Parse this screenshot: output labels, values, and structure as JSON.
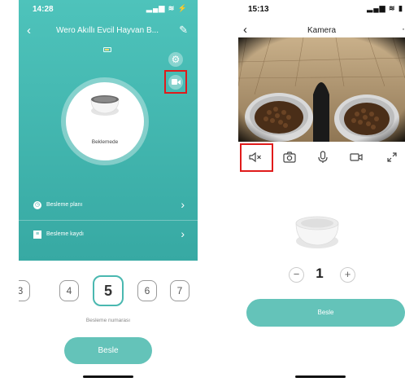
{
  "left": {
    "status": {
      "time": "14:28",
      "signal": "▂▄▆ ≋ ⚡"
    },
    "header": {
      "back": "‹",
      "title": "Wero Akıllı Evcil Hayvan B...",
      "edit": "✎"
    },
    "device_status": "Beklemede",
    "rows": [
      {
        "label": "Besleme planı",
        "icon": "clock-icon",
        "chevron": "›"
      },
      {
        "label": "Besleme kaydı",
        "icon": "list-icon",
        "chevron": "›"
      }
    ],
    "numbers": [
      "3",
      "4",
      "5",
      "6",
      "7"
    ],
    "selected_number": "5",
    "number_label": "Besleme numarası",
    "feed_button": "Besle",
    "colors": {
      "accent": "#4ec3bb",
      "button": "#64c3b9",
      "highlight": "#e01b1b"
    }
  },
  "right": {
    "status": {
      "time": "15:13",
      "signal": "▂▄▆ ≋ ▮"
    },
    "header": {
      "back": "‹",
      "title": "Kamera",
      "more": "·"
    },
    "toolbar": [
      "mute-icon",
      "camera-icon",
      "microphone-icon",
      "video-record-icon",
      "fullscreen-icon"
    ],
    "stepper": {
      "minus": "−",
      "value": "1",
      "plus": "+"
    },
    "feed_button": "Besle"
  }
}
